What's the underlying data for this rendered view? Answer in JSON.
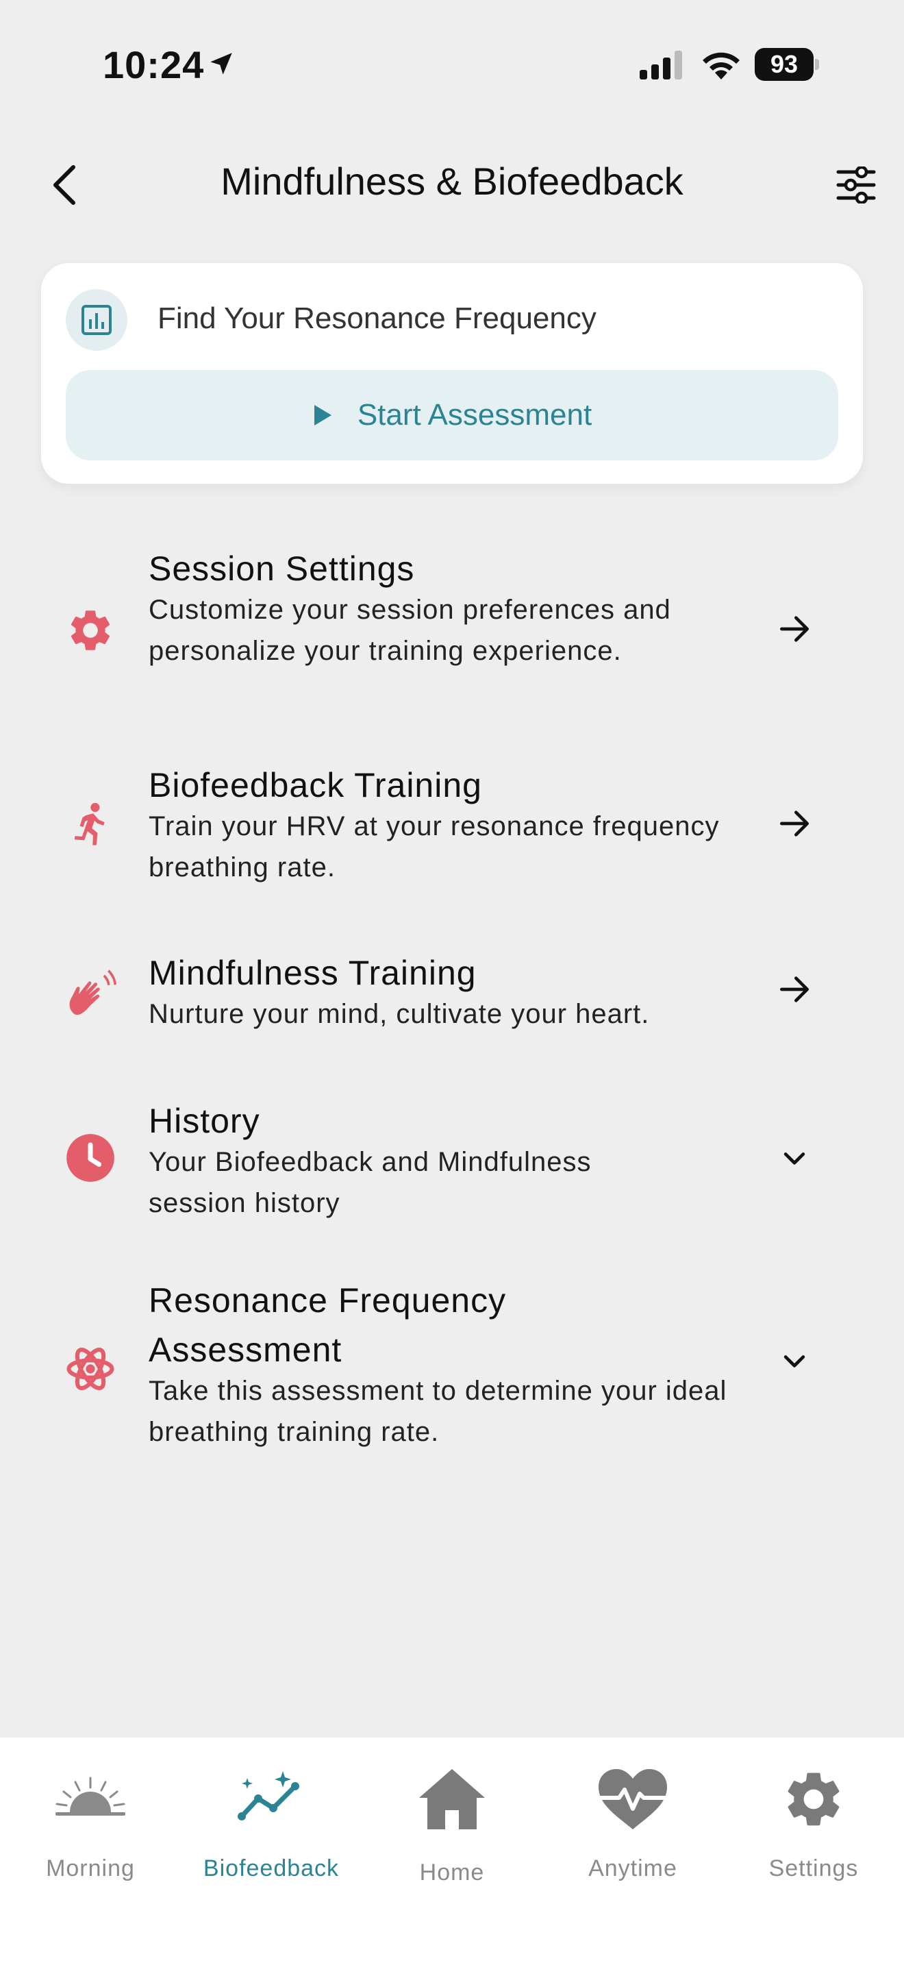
{
  "status_bar": {
    "time": "10:24",
    "battery": "93"
  },
  "header": {
    "title": "Mindfulness & Biofeedback"
  },
  "assessment_card": {
    "title": "Find Your Resonance Frequency",
    "start_label": "Start Assessment"
  },
  "items": [
    {
      "title": "Session Settings",
      "description": "Customize your session preferences and personalize your training experience.",
      "icon": "gear-icon",
      "action": "arrow-right"
    },
    {
      "title": "Biofeedback Training",
      "description": "Train your HRV at your resonance frequency breathing rate.",
      "icon": "running-person-icon",
      "action": "arrow-right"
    },
    {
      "title": "Mindfulness Training",
      "description": "Nurture your mind, cultivate your heart.",
      "icon": "hands-icon",
      "action": "arrow-right"
    },
    {
      "title": "History",
      "description": "Your Biofeedback and Mindfulness session history",
      "icon": "clock-icon",
      "action": "chevron-down"
    },
    {
      "title": "Resonance Frequency Assessment",
      "description": "Take this assessment to determine your ideal breathing training rate.",
      "icon": "atom-icon",
      "action": "chevron-down"
    }
  ],
  "tabbar": {
    "tabs": [
      {
        "label": "Morning",
        "icon": "sunrise-icon"
      },
      {
        "label": "Biofeedback",
        "icon": "sparkle-chart-icon",
        "active": true
      },
      {
        "label": "Home",
        "icon": "home-icon"
      },
      {
        "label": "Anytime",
        "icon": "heart-pulse-icon"
      },
      {
        "label": "Settings",
        "icon": "gear-icon"
      }
    ]
  },
  "colors": {
    "accent": "#2a8494",
    "icon_red": "#e35d6a",
    "background": "#eeeeee",
    "inactive_tab": "#8a8a8a"
  }
}
